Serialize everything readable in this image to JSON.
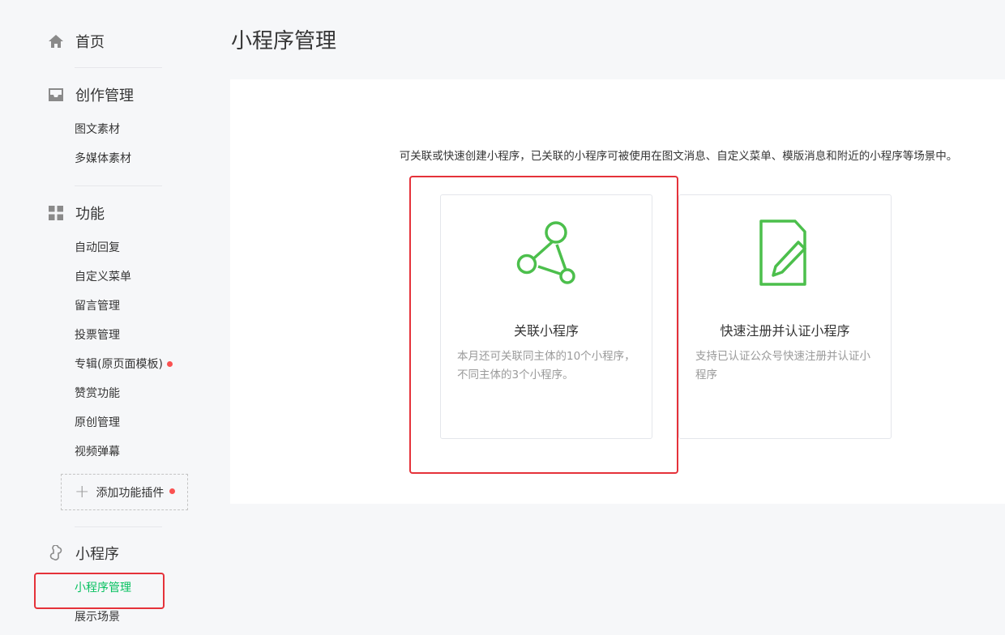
{
  "sidebar": {
    "home": {
      "label": "首页",
      "icon": "home-icon"
    },
    "creation": {
      "label": "创作管理",
      "icon": "inbox-icon",
      "items": [
        "图文素材",
        "多媒体素材"
      ]
    },
    "features": {
      "label": "功能",
      "icon": "grid-icon",
      "items": [
        "自动回复",
        "自定义菜单",
        "留言管理",
        "投票管理",
        "专辑(原页面模板)",
        "赞赏功能",
        "原创管理",
        "视频弹幕"
      ],
      "add_plugin_label": "添加功能插件"
    },
    "miniprogram": {
      "label": "小程序",
      "icon": "link-icon",
      "items": [
        "小程序管理",
        "展示场景"
      ]
    }
  },
  "main": {
    "title": "小程序管理",
    "description": "可关联或快速创建小程序，已关联的小程序可被使用在图文消息、自定义菜单、模版消息和附近的小程序等场景中。",
    "cards": [
      {
        "title": "关联小程序",
        "desc": "本月还可关联同主体的10个小程序，不同主体的3个小程序。",
        "icon": "network-link-icon"
      },
      {
        "title": "快速注册并认证小程序",
        "desc": "支持已认证公众号快速注册并认证小程序",
        "icon": "document-edit-icon"
      }
    ]
  },
  "colors": {
    "accent": "#07c160",
    "highlight": "#e5323a",
    "icon_green": "#4cbf4c"
  }
}
